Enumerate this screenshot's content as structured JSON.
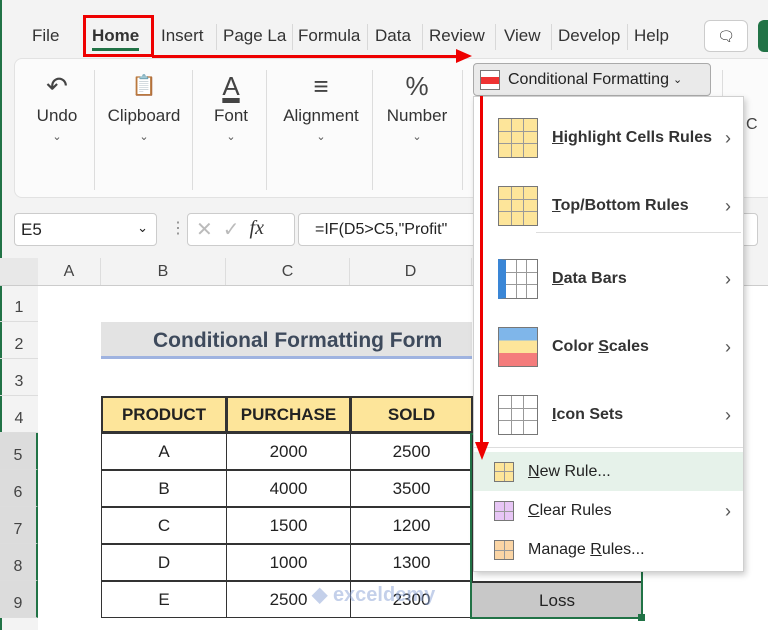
{
  "tabs": [
    "File",
    "Home",
    "Insert",
    "Page La",
    "Formula",
    "Data",
    "Review",
    "View",
    "Develop",
    "Help"
  ],
  "ribbon": {
    "groups": [
      {
        "label": "Undo",
        "icon": "↶"
      },
      {
        "label": "Clipboard",
        "icon": "📋"
      },
      {
        "label": "Font",
        "icon": "A"
      },
      {
        "label": "Alignment",
        "icon": "≡"
      },
      {
        "label": "Number",
        "icon": "%"
      }
    ],
    "cf_button": "Conditional Formatting",
    "partial": "C"
  },
  "formula_bar": {
    "name_box": "E5",
    "formula": "=IF(D5>C5,\"Profit\"",
    "fx": "fx"
  },
  "columns": [
    "A",
    "B",
    "C",
    "D"
  ],
  "rows": [
    "1",
    "2",
    "3",
    "4",
    "5",
    "6",
    "7",
    "8",
    "9"
  ],
  "sheet": {
    "title": "Conditional Formatting Form",
    "headers": [
      "PRODUCT",
      "PURCHASE",
      "SOLD"
    ],
    "data": [
      [
        "A",
        "2000",
        "2500"
      ],
      [
        "B",
        "4000",
        "3500"
      ],
      [
        "C",
        "1500",
        "1200"
      ],
      [
        "D",
        "1000",
        "1300"
      ],
      [
        "E",
        "2500",
        "2300"
      ]
    ],
    "e9": "Loss"
  },
  "menu": {
    "items": [
      {
        "label": "Highlight Cells Rules",
        "key": "H",
        "rest": "ighlight Cells Rules"
      },
      {
        "label": "Top/Bottom Rules",
        "key": "T",
        "rest": "op/Bottom Rules"
      },
      {
        "label": "Data Bars",
        "key": "D",
        "rest": "ata Bars"
      },
      {
        "label": "Color Scales",
        "pre": "Color ",
        "key": "S",
        "rest": "cales"
      },
      {
        "label": "Icon Sets",
        "key": "I",
        "rest": "con Sets"
      },
      {
        "label": "New Rule...",
        "key": "N",
        "rest": "ew Rule..."
      },
      {
        "label": "Clear Rules",
        "key": "C",
        "rest": "lear Rules"
      },
      {
        "label": "Manage Rules...",
        "pre": "Manage ",
        "key": "R",
        "rest": "ules..."
      }
    ]
  },
  "watermark": "exceldemy",
  "colors": {
    "accent_red": "#ee0000",
    "header_fill": "#fde59a",
    "title_fill": "#e3e3e3",
    "hover": "#e6f2ea",
    "excel_green": "#217346"
  }
}
